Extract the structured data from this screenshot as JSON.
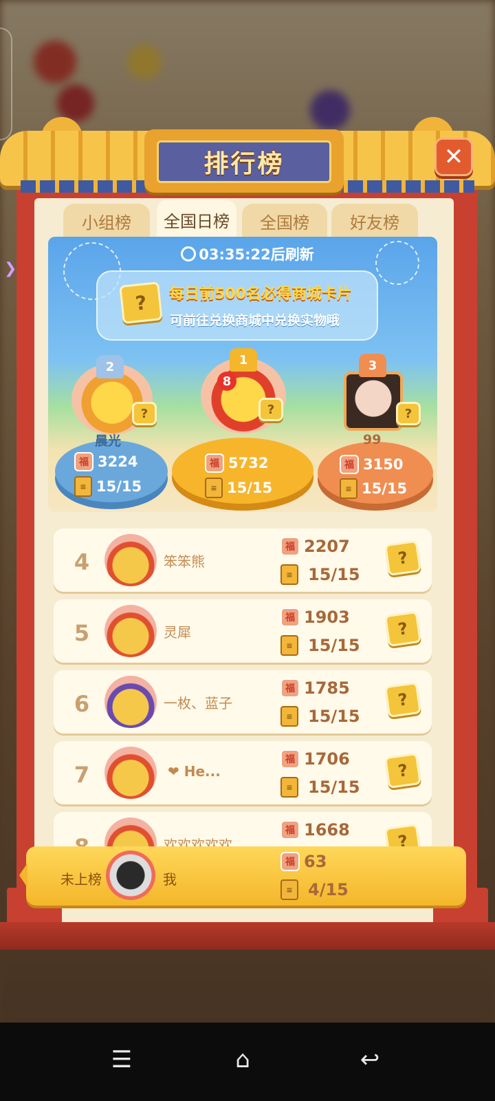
{
  "panel": {
    "title": "排行榜",
    "close": "✕"
  },
  "tabs": [
    "小组榜",
    "全国日榜",
    "全国榜",
    "好友榜"
  ],
  "active_tab": "全国日榜",
  "timer": "03:35:22后刷新",
  "promo": {
    "line1": "每日前500名必得商城卡片",
    "line2": "可前往兑换商城中兑换实物哦"
  },
  "podium": [
    {
      "rank": "2",
      "name": "晨光",
      "score": "3224",
      "chapters": "15/15"
    },
    {
      "rank": "1",
      "name": "",
      "score": "5732",
      "chapters": "15/15",
      "badge": "8"
    },
    {
      "rank": "3",
      "name": "99",
      "score": "3150",
      "chapters": "15/15"
    }
  ],
  "rows": [
    {
      "rank": "4",
      "name": "笨笨熊",
      "score": "2207",
      "chapters": "15/15"
    },
    {
      "rank": "5",
      "name": "灵犀",
      "score": "1903",
      "chapters": "15/15"
    },
    {
      "rank": "6",
      "name": "一枚、蓝子",
      "score": "1785",
      "chapters": "15/15"
    },
    {
      "rank": "7",
      "name": "❤ He...",
      "score": "1706",
      "chapters": "15/15"
    },
    {
      "rank": "8",
      "name": "欢欢欢欢欢",
      "score": "1668",
      "chapters": ""
    }
  ],
  "me": {
    "status": "未上榜",
    "name": "我",
    "score": "63",
    "chapters": "4/15"
  },
  "icons": {
    "fu": "福",
    "book": "book-icon",
    "card": "?"
  },
  "colors": {
    "panel_red": "#c8402f",
    "gold": "#f4b62a",
    "tab_active": "#fff7e2"
  }
}
